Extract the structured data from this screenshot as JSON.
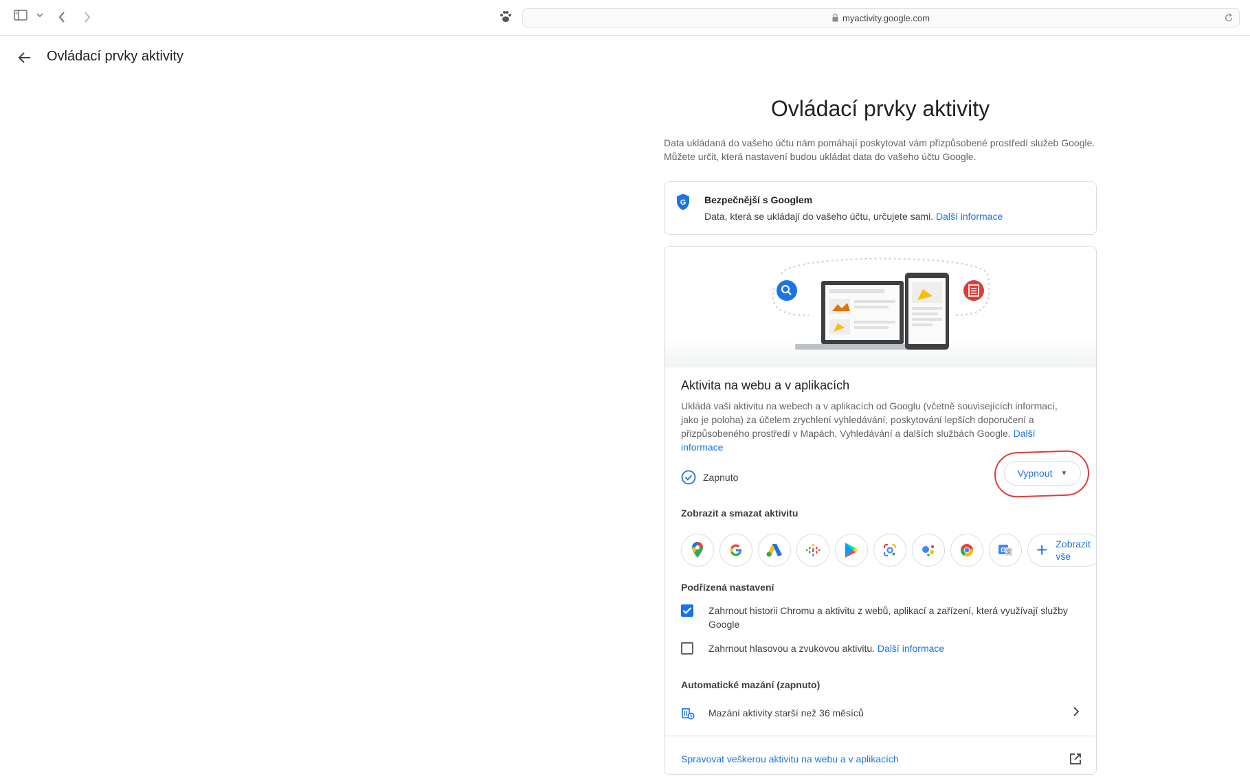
{
  "browser": {
    "url": "myactivity.google.com"
  },
  "header": {
    "title": "Ovládací prvky aktivity"
  },
  "page": {
    "title": "Ovládací prvky aktivity",
    "intro": "Data ukládaná do vašeho účtu nám pomáhají poskytovat vám přizpůsobené prostředí služeb Google. Můžete určit, která nastavení budou ukládat data do vašeho účtu Google."
  },
  "safety_card": {
    "title": "Bezpečnější s Googlem",
    "text": "Data, která se ukládají do vašeho účtu, určujete sami.",
    "link": "Další informace"
  },
  "activity": {
    "title": "Aktivita na webu a v aplikacích",
    "description": "Ukládá vaši aktivitu na webech a v aplikacích od Googlu (včetně souvisejících informací, jako je poloha) za účelem zrychlení vyhledávání, poskytování lepších doporučení a přizpůsobeného prostředí v Mapách, Vyhledávání a dalších službách Google.",
    "description_link": "Další informace",
    "status": "Zapnuto",
    "turn_off_button": "Vypnout"
  },
  "view_delete": {
    "title": "Zobrazit a smazat aktivitu",
    "apps": [
      "maps-icon",
      "google-search-icon",
      "google-ads-icon",
      "google-podcasts-icon",
      "google-play-icon",
      "google-lens-icon",
      "google-assistant-icon",
      "chrome-icon",
      "google-translate-icon"
    ],
    "show_all_line1": "Zobrazit",
    "show_all_line2": "vše"
  },
  "sub_settings": {
    "title": "Podřízená nastavení",
    "chrome_history": "Zahrnout historii Chromu a aktivitu z webů, aplikací a zařízení, která využívají služby Google",
    "chrome_history_checked": true,
    "voice": "Zahrnout hlasovou a zvukovou aktivitu.",
    "voice_link": "Další informace",
    "voice_checked": false
  },
  "auto_delete": {
    "title": "Automatické mazání (zapnuto)",
    "text": "Mazání aktivity starší než 36 měsíců"
  },
  "manage": {
    "link": "Spravovat veškerou aktivitu na webu a v aplikacích"
  },
  "colors": {
    "accent": "#1a73e8",
    "highlight": "#e53935"
  }
}
